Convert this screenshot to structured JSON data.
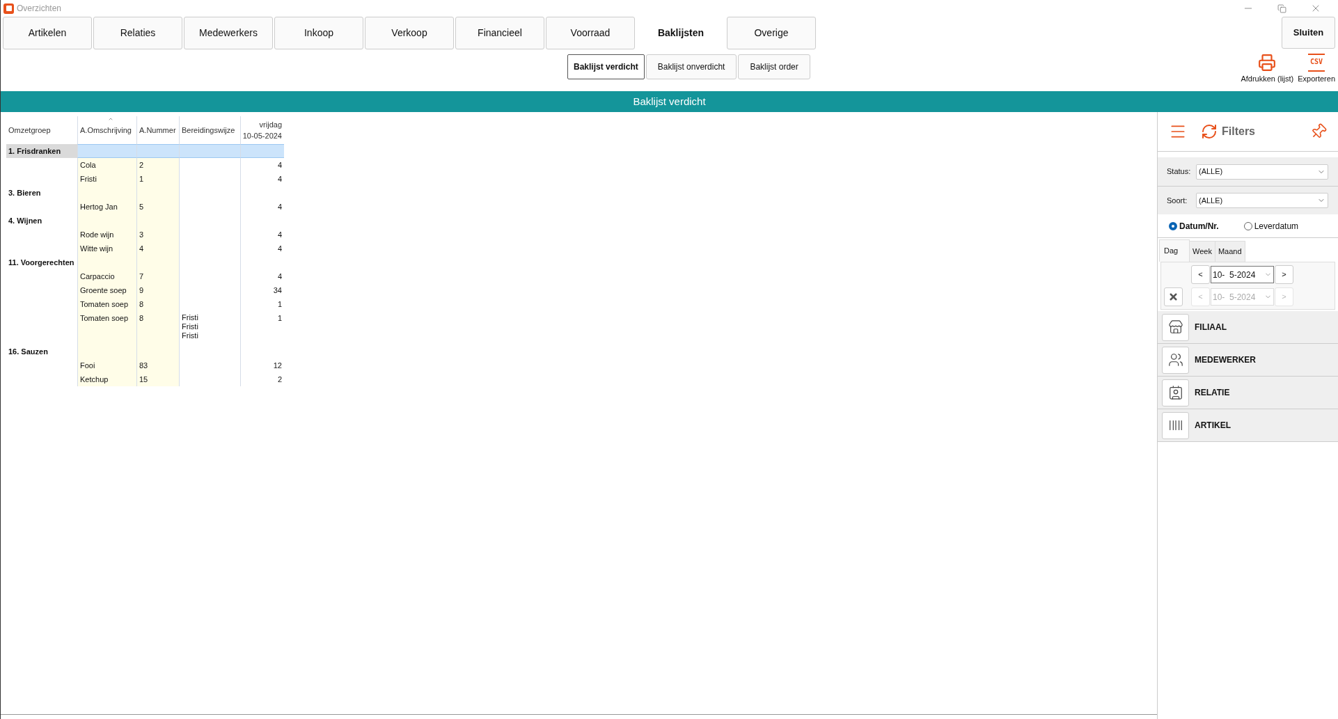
{
  "window": {
    "title": "Overzichten"
  },
  "tabs": [
    {
      "label": "Artikelen",
      "selected": false
    },
    {
      "label": "Relaties",
      "selected": false
    },
    {
      "label": "Medewerkers",
      "selected": false
    },
    {
      "label": "Inkoop",
      "selected": false
    },
    {
      "label": "Verkoop",
      "selected": false
    },
    {
      "label": "Financieel",
      "selected": false
    },
    {
      "label": "Voorraad",
      "selected": false
    },
    {
      "label": "Baklijsten",
      "selected": true
    },
    {
      "label": "Overige",
      "selected": false
    }
  ],
  "subtabs": [
    {
      "label": "Baklijst verdicht",
      "selected": true
    },
    {
      "label": "Baklijst onverdicht",
      "selected": false
    },
    {
      "label": "Baklijst order",
      "selected": false
    }
  ],
  "close_button": "Sluiten",
  "actions": [
    {
      "kind": "print",
      "label": "Afdrukken (lijst)"
    },
    {
      "kind": "csv",
      "label": "Exporteren",
      "icon_text": "CSV"
    }
  ],
  "banner": "Baklijst verdicht",
  "table": {
    "columns": [
      {
        "label": "Omzetgroep",
        "sorted": false
      },
      {
        "label": "A.Omschrijving",
        "sorted": true
      },
      {
        "label": "A.Nummer",
        "sorted": false
      },
      {
        "label": "Bereidingswijze",
        "sorted": false
      },
      {
        "label": "vrijdag",
        "label2": "10-05-2024",
        "sorted": false
      }
    ],
    "rows": [
      {
        "kind": "group",
        "label": "1. Frisdranken",
        "selected": true
      },
      {
        "kind": "item",
        "description": "Cola",
        "number": "2",
        "quantity": "4",
        "selected": false
      },
      {
        "kind": "item",
        "description": "Fristi",
        "number": "1",
        "quantity": "4",
        "selected": false
      },
      {
        "kind": "group",
        "label": "3. Bieren",
        "selected": false
      },
      {
        "kind": "item",
        "description": "Hertog Jan",
        "number": "5",
        "quantity": "4",
        "selected": false
      },
      {
        "kind": "group",
        "label": "4. Wijnen",
        "selected": false
      },
      {
        "kind": "item",
        "description": "Rode wijn",
        "number": "3",
        "quantity": "4",
        "selected": false
      },
      {
        "kind": "item",
        "description": "Witte wijn",
        "number": "4",
        "quantity": "4",
        "selected": false
      },
      {
        "kind": "group",
        "label": "11. Voorgerechten",
        "selected": false
      },
      {
        "kind": "item",
        "description": "Carpaccio",
        "number": "7",
        "quantity": "4",
        "selected": false
      },
      {
        "kind": "item",
        "description": "Groente soep",
        "number": "9",
        "quantity": "34",
        "selected": false
      },
      {
        "kind": "item",
        "description": "Tomaten soep",
        "number": "8",
        "quantity": "1",
        "selected": false
      },
      {
        "kind": "item",
        "description": "Tomaten soep",
        "number": "8",
        "quantity": "1",
        "preparation": [
          "Fristi",
          "Fristi",
          "Fristi"
        ],
        "selected": false
      },
      {
        "kind": "group",
        "label": "16. Sauzen",
        "selected": false
      },
      {
        "kind": "item",
        "description": "Fooi",
        "number": "83",
        "quantity": "12",
        "selected": false
      },
      {
        "kind": "item",
        "description": "Ketchup",
        "number": "15",
        "quantity": "2",
        "selected": false
      }
    ]
  },
  "filters": {
    "title": "Filters",
    "selects": [
      {
        "label": "Status:",
        "value": "(ALLE)"
      },
      {
        "label": "Soort:",
        "value": "(ALLE)"
      }
    ],
    "radios": [
      {
        "label": "Datum/Nr.",
        "selected": true
      },
      {
        "label": "Leverdatum",
        "selected": false
      }
    ],
    "period_tabs": [
      {
        "label": "Dag",
        "selected": true
      },
      {
        "label": "Week",
        "selected": false
      },
      {
        "label": "Maand",
        "selected": false
      }
    ],
    "dates": [
      {
        "prev": "<",
        "value": "10-  5-2024",
        "next": ">",
        "disabled": false
      },
      {
        "prev": "<",
        "value": "10-  5-2024",
        "next": ">",
        "disabled": true
      }
    ],
    "sections": [
      {
        "kind": "store",
        "label": "FILIAAL"
      },
      {
        "kind": "people",
        "label": "MEDEWERKER"
      },
      {
        "kind": "contact",
        "label": "RELATIE"
      },
      {
        "kind": "barcode",
        "label": "ARTIKEL"
      }
    ]
  }
}
